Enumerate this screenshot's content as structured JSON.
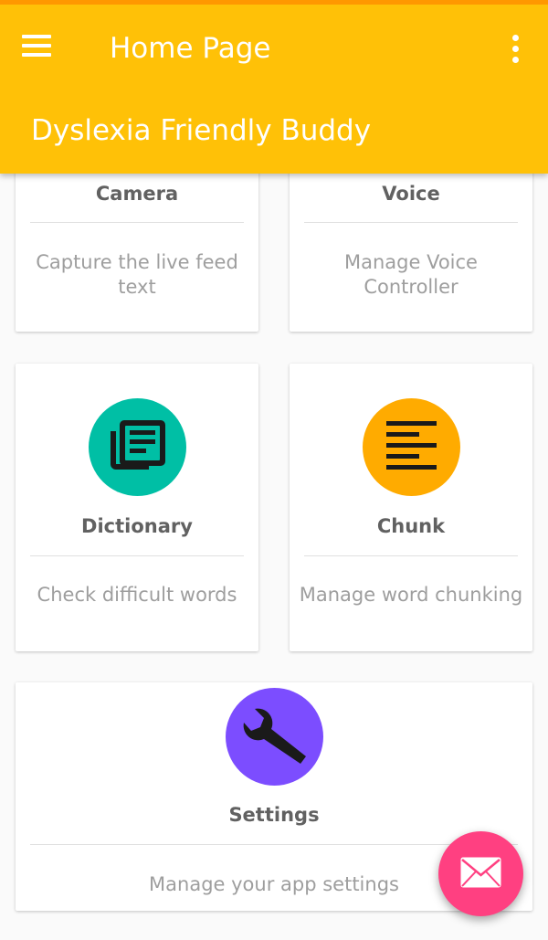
{
  "toolbar": {
    "title": "Home Page",
    "menu_icon": "hamburger-menu-icon",
    "overflow_icon": "more-vert-icon",
    "background": "#ffc107"
  },
  "subheader": {
    "title": "Dyslexia Friendly Buddy"
  },
  "cards": {
    "camera": {
      "title": "Camera",
      "description": "Capture the live feed text"
    },
    "voice": {
      "title": "Voice",
      "description": "Manage Voice Controller"
    },
    "dictionary": {
      "title": "Dictionary",
      "description": "Check difficult words",
      "icon": "library-books-icon",
      "icon_color": "#00bfa5"
    },
    "chunk": {
      "title": "Chunk",
      "description": "Manage word chunking",
      "icon": "align-left-icon",
      "icon_color": "#ffab00"
    },
    "settings": {
      "title": "Settings",
      "description": "Manage your app settings",
      "icon": "wrench-icon",
      "icon_color": "#7c4dff"
    }
  },
  "fab": {
    "icon": "mail-icon",
    "color": "#ff4081"
  }
}
